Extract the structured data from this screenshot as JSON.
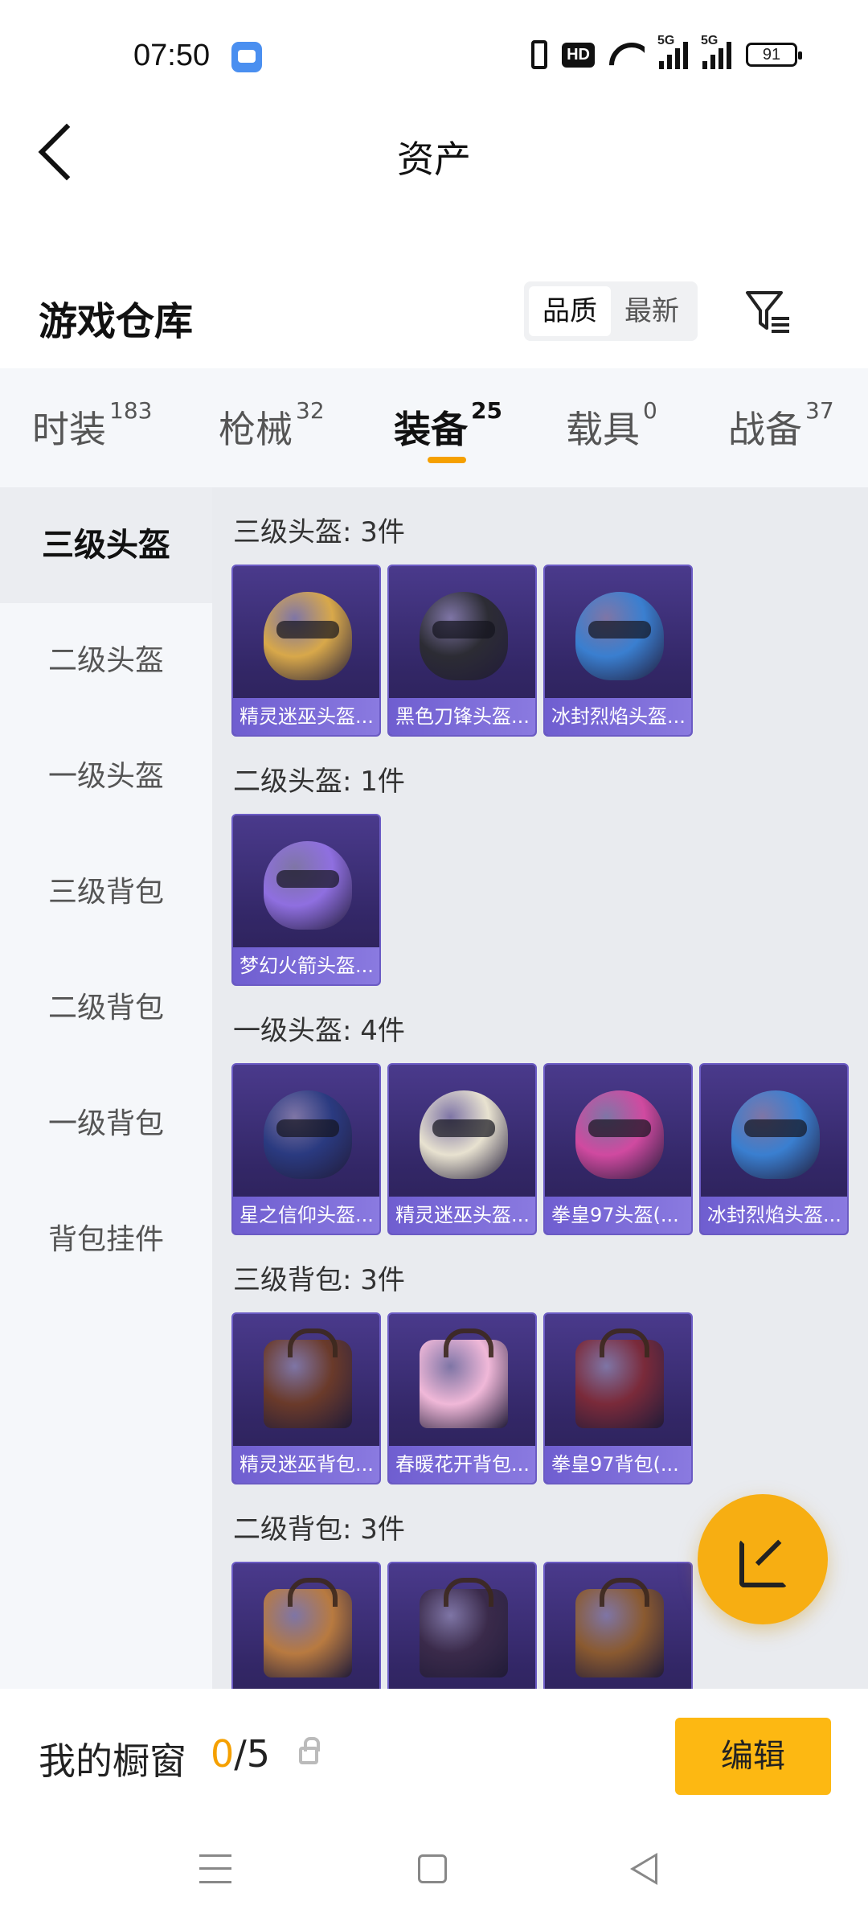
{
  "status_bar": {
    "time": "07:50",
    "hd_label": "HD",
    "sim1_label": "5G",
    "sim2_label": "5G",
    "battery": "91"
  },
  "header": {
    "title": "资产",
    "back_icon": "chevron-left-icon"
  },
  "section": {
    "title": "游戏仓库",
    "sort_options": [
      "品质",
      "最新"
    ],
    "active_sort": "品质",
    "filter_icon": "filter-icon"
  },
  "tabs": [
    {
      "label": "时装",
      "count": "183"
    },
    {
      "label": "枪械",
      "count": "32"
    },
    {
      "label": "装备",
      "count": "25"
    },
    {
      "label": "载具",
      "count": "0"
    },
    {
      "label": "战备",
      "count": "37"
    }
  ],
  "active_tab": "装备",
  "sidebar": {
    "items": [
      "三级头盔",
      "二级头盔",
      "一级头盔",
      "三级背包",
      "二级背包",
      "一级背包",
      "背包挂件"
    ],
    "active": "三级头盔"
  },
  "groups": [
    {
      "title": "三级头盔: 3件",
      "items": [
        {
          "name": "精灵迷巫头盔...",
          "color": "#d8a84a"
        },
        {
          "name": "黑色刀锋头盔...",
          "color": "#2c2c34"
        },
        {
          "name": "冰封烈焰头盔...",
          "color": "#3a7fd0"
        }
      ]
    },
    {
      "title": "二级头盔: 1件",
      "items": [
        {
          "name": "梦幻火箭头盔...",
          "color": "#8f6fe0"
        }
      ]
    },
    {
      "title": "一级头盔: 4件",
      "items": [
        {
          "name": "星之信仰头盔...",
          "color": "#2a3a80"
        },
        {
          "name": "精灵迷巫头盔...",
          "color": "#e8e2d0"
        },
        {
          "name": "拳皇97头盔(...",
          "color": "#d04aa0"
        },
        {
          "name": "冰封烈焰头盔...",
          "color": "#3a7fd0"
        }
      ]
    },
    {
      "title": "三级背包: 3件",
      "items": [
        {
          "name": "精灵迷巫背包...",
          "color": "#6a3a2a"
        },
        {
          "name": "春暖花开背包...",
          "color": "#f0b8d8"
        },
        {
          "name": "拳皇97背包(...",
          "color": "#7a2a3a"
        }
      ]
    },
    {
      "title": "二级背包: 3件",
      "items": [
        {
          "name": "",
          "color": "#b87a40"
        },
        {
          "name": "",
          "color": "#3a2a4a"
        },
        {
          "name": "",
          "color": "#8a5a30"
        }
      ]
    }
  ],
  "fab": {
    "icon": "share-icon"
  },
  "showcase": {
    "label": "我的橱窗",
    "current": "0",
    "separator": "/",
    "total": "5",
    "lock_icon": "lock-icon",
    "edit_label": "编辑"
  },
  "nav": {
    "menu_icon": "menu-icon",
    "home_icon": "home-icon",
    "back_icon": "back-triangle-icon"
  },
  "colors": {
    "accent": "#f5a000",
    "edit_button": "#fdb812",
    "card_label": "#7a6ad8"
  }
}
